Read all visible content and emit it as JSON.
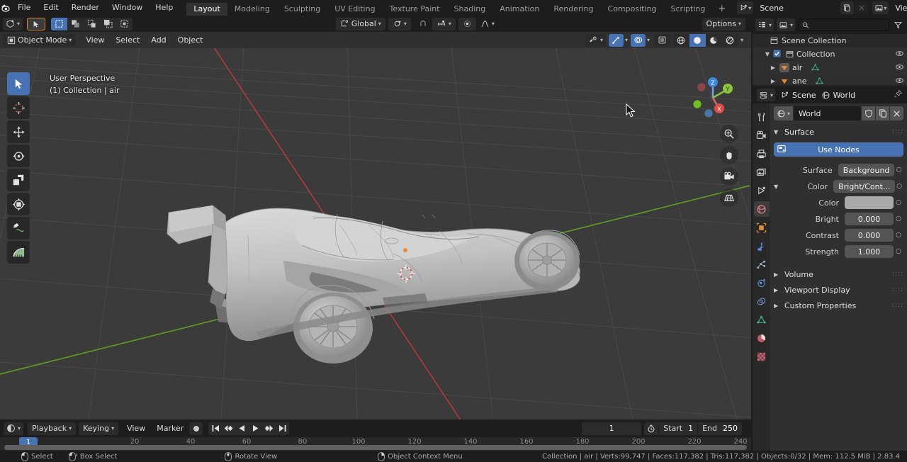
{
  "app": {
    "title": "Blender",
    "version": "2.83.4"
  },
  "topbar": {
    "logo_icon": "blender-logo-icon",
    "menus": [
      "File",
      "Edit",
      "Render",
      "Window",
      "Help"
    ],
    "workspaces": [
      {
        "label": "Layout",
        "active": true
      },
      {
        "label": "Modeling",
        "active": false
      },
      {
        "label": "Sculpting",
        "active": false
      },
      {
        "label": "UV Editing",
        "active": false
      },
      {
        "label": "Texture Paint",
        "active": false
      },
      {
        "label": "Shading",
        "active": false
      },
      {
        "label": "Animation",
        "active": false
      },
      {
        "label": "Rendering",
        "active": false
      },
      {
        "label": "Compositing",
        "active": false
      },
      {
        "label": "Scripting",
        "active": false
      }
    ],
    "add_workspace_label": "+",
    "scene": {
      "icon": "scene-icon",
      "name": "Scene",
      "new_icon": "copy-icon",
      "unlink_icon": "close-icon"
    },
    "view_layer": {
      "icon": "view-layer-icon",
      "name": "View Layer",
      "new_icon": "copy-icon",
      "unlink_icon": "close-icon"
    }
  },
  "viewport": {
    "editor_type_icon": "editor-type-3dview-icon",
    "mode": "Object Mode",
    "menus": [
      "View",
      "Select",
      "Add",
      "Object"
    ],
    "select_mode_icons": [
      "select-box-icon",
      "select-extend-icon",
      "select-subtract-icon",
      "select-invert-icon",
      "select-intersect-icon"
    ],
    "cursor_tool_icon": "cursor-tool-icon",
    "transform_orientation": "Global",
    "snap_icon": "snap-magnet-icon",
    "snap_target_icon": "snap-increment-icon",
    "proportional_icon": "proportional-edit-icon",
    "falloff_icon": "falloff-smooth-icon",
    "options_label": "Options",
    "overlay_text_line1": "User Perspective",
    "overlay_text_line2": "(1) Collection | air",
    "shading_modes": [
      "wireframe",
      "solid",
      "material-preview",
      "rendered"
    ],
    "active_shading_mode": "solid",
    "visibility_icon": "show-hide-icon",
    "gizmo_icon": "gizmo-icon",
    "overlays_icon": "overlays-icon",
    "xray_icon": "xray-toggle-icon",
    "gizmo_axes": [
      "X",
      "Y",
      "Z"
    ],
    "nav_buttons": [
      "zoom-icon",
      "hand-pan-icon",
      "camera-view-icon",
      "toggle-ortho-icon"
    ],
    "tools": [
      {
        "name": "tweak-tool",
        "active": true
      },
      {
        "name": "cursor-tool",
        "active": false
      },
      {
        "name": "move-tool",
        "active": false
      },
      {
        "name": "rotate-tool",
        "active": false
      },
      {
        "name": "scale-tool",
        "active": false
      },
      {
        "name": "transform-tool",
        "active": false
      },
      {
        "name": "annotate-tool",
        "active": false
      },
      {
        "name": "measure-tool",
        "active": false
      }
    ],
    "object_label": "3d-car-model"
  },
  "timeline": {
    "editor_type_icon": "editor-type-timeline-icon",
    "menus": [
      "Playback",
      "Keying",
      "View",
      "Marker"
    ],
    "record_icon": "record-keyframes-icon",
    "transport_icons": [
      "jump-start-icon",
      "prev-keyframe-icon",
      "play-reverse-icon",
      "play-icon",
      "next-keyframe-icon",
      "jump-end-icon"
    ],
    "current_frame": "1",
    "timer_icon": "use-preview-range-icon",
    "start_label": "Start",
    "start_value": "1",
    "end_label": "End",
    "end_value": "250",
    "ruler_ticks": [
      "20",
      "40",
      "60",
      "80",
      "100",
      "120",
      "140",
      "160",
      "180",
      "200",
      "220",
      "240"
    ],
    "playhead_label": "1"
  },
  "outliner": {
    "display_mode_icon": "outliner-display-mode-icon",
    "filter_id_icon": "outliner-id-type-icon",
    "search_icon": "search-icon",
    "search_value": "",
    "search_placeholder": "",
    "filter_icon": "filter-funnel-icon",
    "rows": [
      {
        "label": "Scene Collection",
        "icon": "collection-icon",
        "indent": 0,
        "disclosure": "",
        "checkbox": false,
        "eye": false
      },
      {
        "label": "Collection",
        "icon": "collection-icon",
        "indent": 1,
        "disclosure": "▼",
        "checkbox": true,
        "eye": true
      },
      {
        "label": "air",
        "icon": "mesh-object-icon",
        "indent": 2,
        "disclosure": "▶",
        "checkbox": false,
        "eye": true,
        "data_icon": "mesh-data-icon",
        "selected": true
      },
      {
        "label": "ane",
        "icon": "mesh-object-icon",
        "indent": 2,
        "disclosure": "▶",
        "checkbox": false,
        "eye": true,
        "data_icon": "mesh-data-icon",
        "selected": false
      }
    ]
  },
  "properties": {
    "editor_type_icon": "editor-type-properties-icon",
    "breadcrumb": [
      {
        "label": "Scene",
        "icon": "scene-icon"
      },
      {
        "label": "World",
        "icon": "world-icon"
      }
    ],
    "pin_icon": "pin-icon",
    "tabs": [
      {
        "name": "tool-tab",
        "icon": "tool-icon",
        "active": false
      },
      {
        "name": "render-tab",
        "icon": "render-camera-icon",
        "active": false
      },
      {
        "name": "output-tab",
        "icon": "printer-icon",
        "active": false
      },
      {
        "name": "view-layer-tab",
        "icon": "images-icon",
        "active": false
      },
      {
        "name": "scene-tab",
        "icon": "scene-icon",
        "active": false
      },
      {
        "name": "world-tab",
        "icon": "world-icon",
        "active": true
      },
      {
        "name": "object-tab",
        "icon": "object-square-icon",
        "active": false
      },
      {
        "name": "modifiers-tab",
        "icon": "wrench-icon",
        "active": false
      },
      {
        "name": "particles-tab",
        "icon": "particles-icon",
        "active": false
      },
      {
        "name": "physics-tab",
        "icon": "physics-orbit-icon",
        "active": false
      },
      {
        "name": "constraints-tab",
        "icon": "constraints-icon",
        "active": false
      },
      {
        "name": "data-tab",
        "icon": "mesh-data-icon",
        "active": false
      },
      {
        "name": "material-tab",
        "icon": "material-sphere-icon",
        "active": false
      },
      {
        "name": "texture-tab",
        "icon": "texture-checker-icon",
        "active": false
      }
    ],
    "id_block": {
      "browse_icon": "world-browse-icon",
      "name": "World",
      "fake_user_icon": "shield-icon",
      "new_icon": "copy-icon",
      "unlink_icon": "close-icon"
    },
    "surface_panel": {
      "title": "Surface",
      "use_nodes_label": "Use Nodes",
      "use_nodes_icon": "nodes-icon",
      "rows": [
        {
          "label": "Surface",
          "value": "Background",
          "type": "enum",
          "decorator": "○"
        },
        {
          "label": "Color",
          "value": "Bright/Cont...",
          "type": "enum",
          "decorator": "○",
          "expand_tri": "▼"
        },
        {
          "label": "Color",
          "value": "",
          "type": "color",
          "decorator": "○",
          "swatch": "#a9a9a9"
        },
        {
          "label": "Bright",
          "value": "0.000",
          "type": "number",
          "decorator": "○"
        },
        {
          "label": "Contrast",
          "value": "0.000",
          "type": "number",
          "decorator": "○"
        },
        {
          "label": "Strength",
          "value": "1.000",
          "type": "number",
          "decorator": "○"
        }
      ]
    },
    "closed_panels": [
      {
        "label": "Volume"
      },
      {
        "label": "Viewport Display"
      },
      {
        "label": "Custom Properties"
      }
    ]
  },
  "statusbar": {
    "hints": [
      {
        "icon": "mouse-left-icon",
        "label": "Select"
      },
      {
        "icon": "mouse-left-drag-icon",
        "label": "Box Select"
      },
      {
        "icon": "mouse-middle-icon",
        "label": "Rotate View"
      },
      {
        "icon": "mouse-right-icon",
        "label": "Object Context Menu"
      }
    ],
    "stats": "Collection | air | Verts:99,747 | Faces:117,382 | Tris:117,382 | Objects:0/32 | Mem: 112.5 MiB | 2.83.4"
  },
  "colors": {
    "accent": "#4772b3",
    "editor_bg": "#303030",
    "header_bg": "#1d1d1d",
    "panel_bg": "#282828",
    "field_bg": "#545454",
    "viewport_bg": "#3b3b3b",
    "axis_x": "#cc3b42",
    "axis_y": "#6ec200"
  }
}
